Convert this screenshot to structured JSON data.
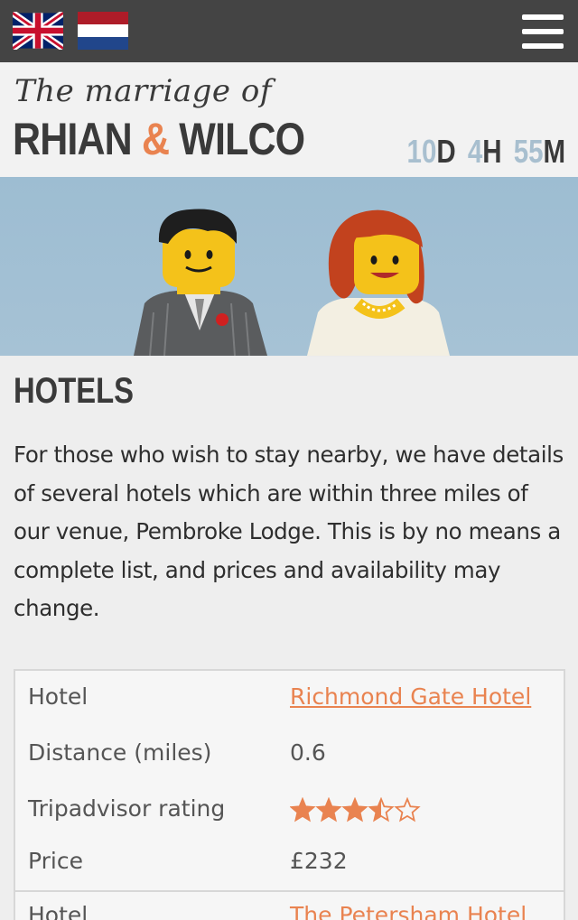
{
  "nav": {
    "flags": [
      {
        "name": "uk-flag-icon",
        "lang": "English"
      },
      {
        "name": "nl-flag-icon",
        "lang": "Dutch"
      }
    ],
    "menu_icon": "hamburger-menu-icon"
  },
  "header": {
    "script_title": "The marriage of",
    "name_one": "RHIAN",
    "ampersand": "&",
    "name_two": "WILCO",
    "countdown": {
      "days": "10",
      "days_unit": "D",
      "hours": "4",
      "hours_unit": "H",
      "minutes": "55",
      "minutes_unit": "M"
    }
  },
  "page": {
    "title": "HOTELS",
    "intro": "For those who wish to stay nearby, we have details of several hotels which are within three miles of our venue, Pembroke Lodge. This is by no means a complete list, and prices and availability may change."
  },
  "hotels": [
    {
      "hotel_label": "Hotel",
      "hotel_name": "Richmond Gate Hotel",
      "distance_label": "Distance (miles)",
      "distance": "0.6",
      "rating_label": "Tripadvisor  rating",
      "rating": 3.5,
      "rating_max": 5,
      "price_label": "Price",
      "price": "£232"
    },
    {
      "hotel_label": "Hotel",
      "hotel_name": "The Petersham Hotel"
    }
  ],
  "colors": {
    "accent": "#e98350",
    "countdown_number": "#a8bfcf",
    "topbar": "#444444"
  }
}
